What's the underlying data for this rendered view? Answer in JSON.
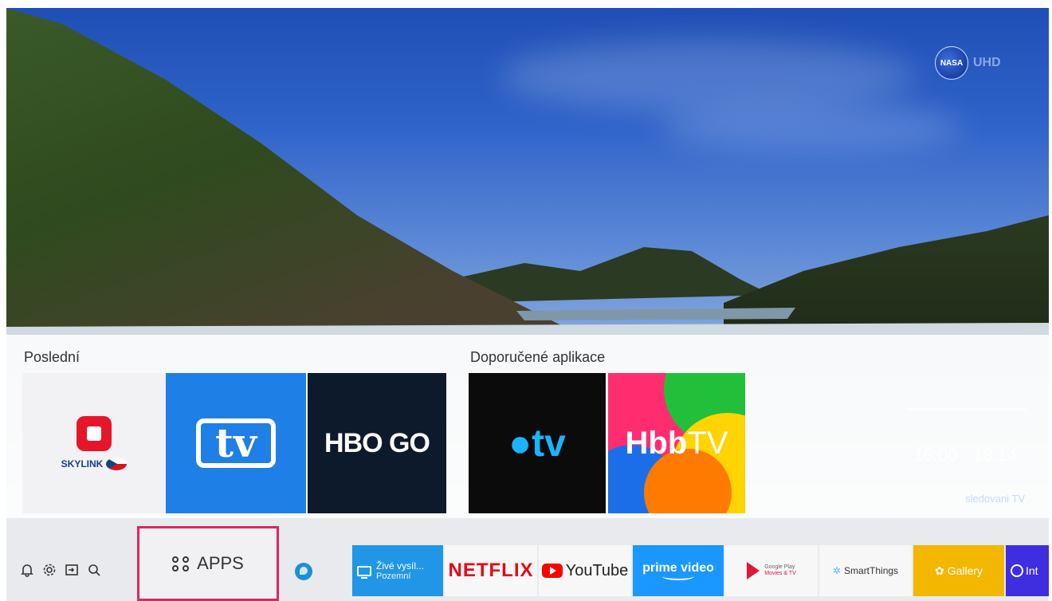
{
  "channel_logo": {
    "badge": "NASA",
    "suffix": "UHD"
  },
  "sections": {
    "recent_title": "Poslední",
    "recommended_title": "Doporučené aplikace"
  },
  "recent_tiles": {
    "skylink": "SKYLINK",
    "tv": "tv",
    "hbo": "HBO GO"
  },
  "recommended_tiles": {
    "appletv": "tv",
    "hbbtv_bold": "Hbb",
    "hbbtv_light": "TV"
  },
  "program": {
    "time": "16:00 - 18:14",
    "brand": "sledovani TV"
  },
  "system_icons": [
    "notification-icon",
    "settings-icon",
    "source-icon",
    "search-icon"
  ],
  "apps_button": {
    "label": "APPS"
  },
  "launcher": {
    "live_line1": "Živé vysíl...",
    "live_line2": "Pozemní",
    "netflix": "NETFLIX",
    "youtube": "YouTube",
    "prime": "prime video",
    "gplay_line1": "Google Play",
    "gplay_line2": "Movies & TV",
    "smartthings": "SmartThings",
    "gallery": "Gallery",
    "internet": "Int"
  },
  "colors": {
    "focus": "#e0265b",
    "netflix": "#e50914",
    "gallery": "#f3b700",
    "internet": "#3f2ee0"
  }
}
